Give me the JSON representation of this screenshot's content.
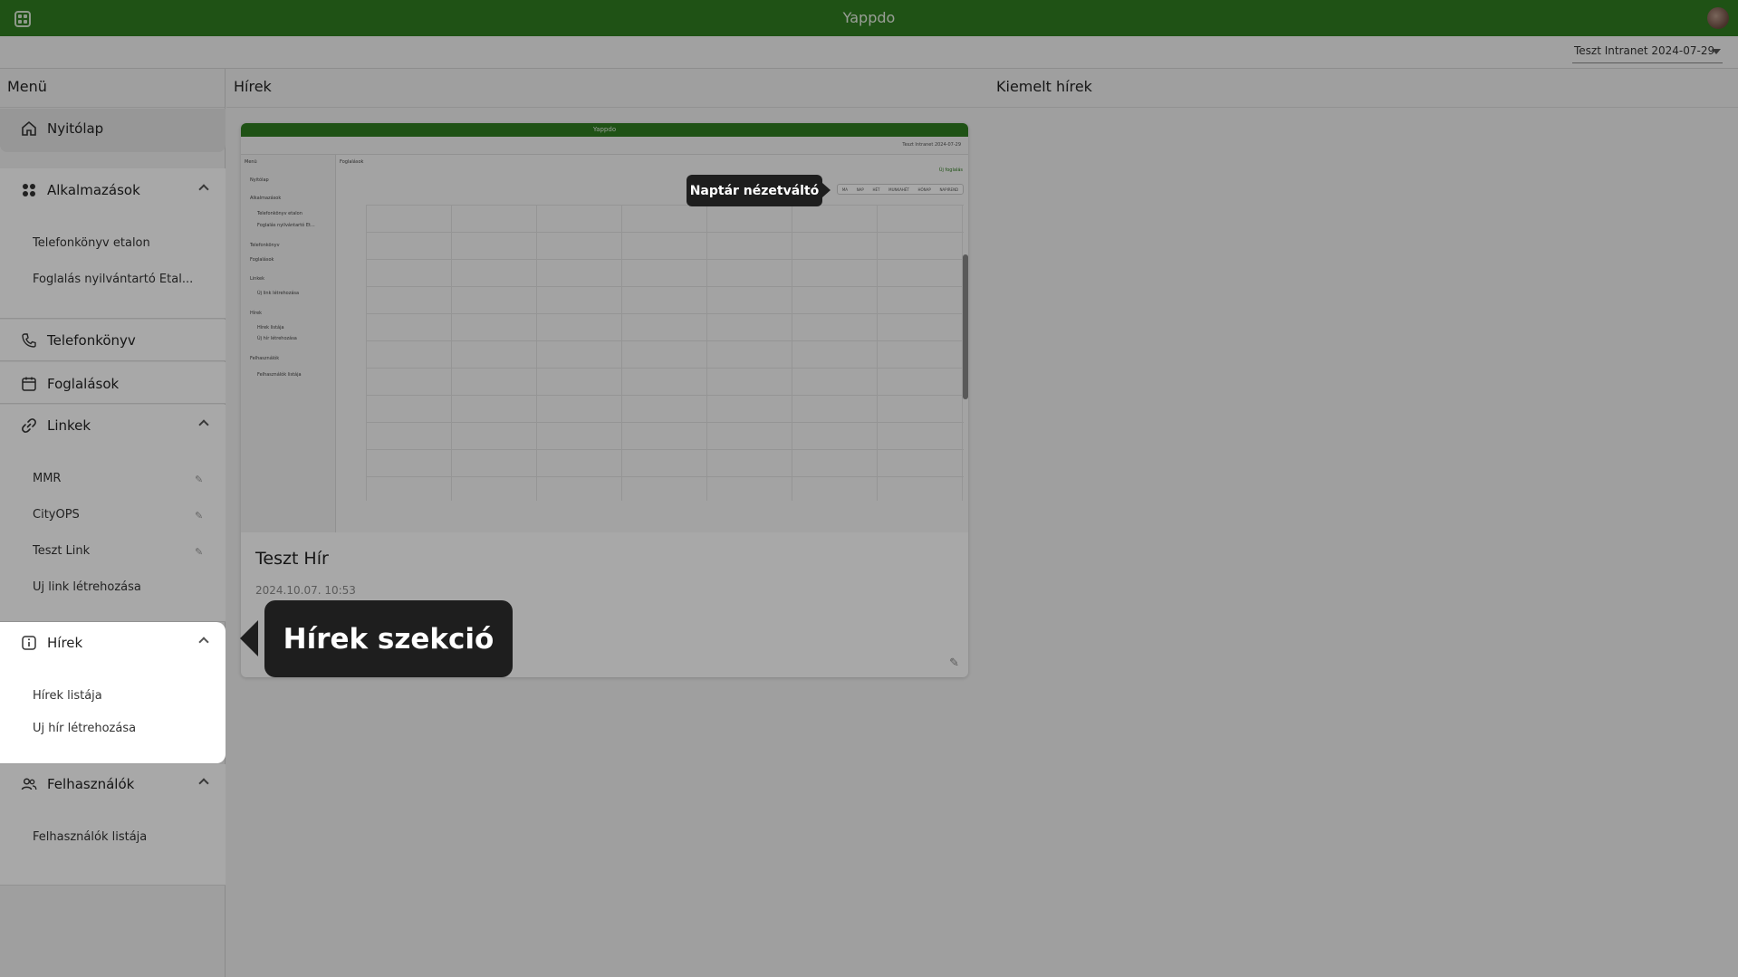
{
  "app": {
    "title": "Yappdo"
  },
  "intranet_select": {
    "value": "Teszt Intranet 2024-07-29"
  },
  "sidebar": {
    "header": "Menü",
    "home": "Nyitólap",
    "apps": {
      "label": "Alkalmazások",
      "items": [
        "Telefonkönyv etalon",
        "Foglalás nyilvántartó Etal..."
      ]
    },
    "phonebook": "Telefonkönyv",
    "bookings": "Foglalások",
    "links": {
      "label": "Linkek",
      "items": [
        "MMR",
        "CityOPS",
        "Teszt Link"
      ],
      "create": "Új link létrehozása"
    },
    "news": {
      "label": "Hírek",
      "items": [
        "Hírek listája",
        "Új hír létrehozása"
      ]
    },
    "users": {
      "label": "Felhasználók",
      "items": [
        "Felhasználók listája"
      ]
    }
  },
  "main": {
    "news_header": "Hírek",
    "featured_header": "Kiemelt hírek",
    "card": {
      "title": "Teszt Hír",
      "date": "2024.10.07. 10:53"
    }
  },
  "mini": {
    "title": "Yappdo",
    "intranet": "Teszt Intranet 2024-07-29",
    "menu": "Menü",
    "page_title": "Foglalások",
    "new_booking": "Új foglalás",
    "side_items": [
      "Nyitólap",
      "Alkalmazások",
      "Telefonkönyv etalon",
      "Foglalás nyilvántartó Et...",
      "Telefonkönyv",
      "Foglalások",
      "Linkek",
      "Új link létrehozása",
      "Hírek",
      "Hírek listája",
      "Új hír létrehozása",
      "Felhasználók",
      "Felhasználók listája"
    ],
    "view_buttons": [
      "MA",
      "NAP",
      "HÉT",
      "MUNKAHÉT",
      "HÓNAP",
      "NAPIREND"
    ]
  },
  "tooltips": {
    "news_section": "Hírek szekció",
    "calendar_view": "Naptár nézetváltó"
  }
}
